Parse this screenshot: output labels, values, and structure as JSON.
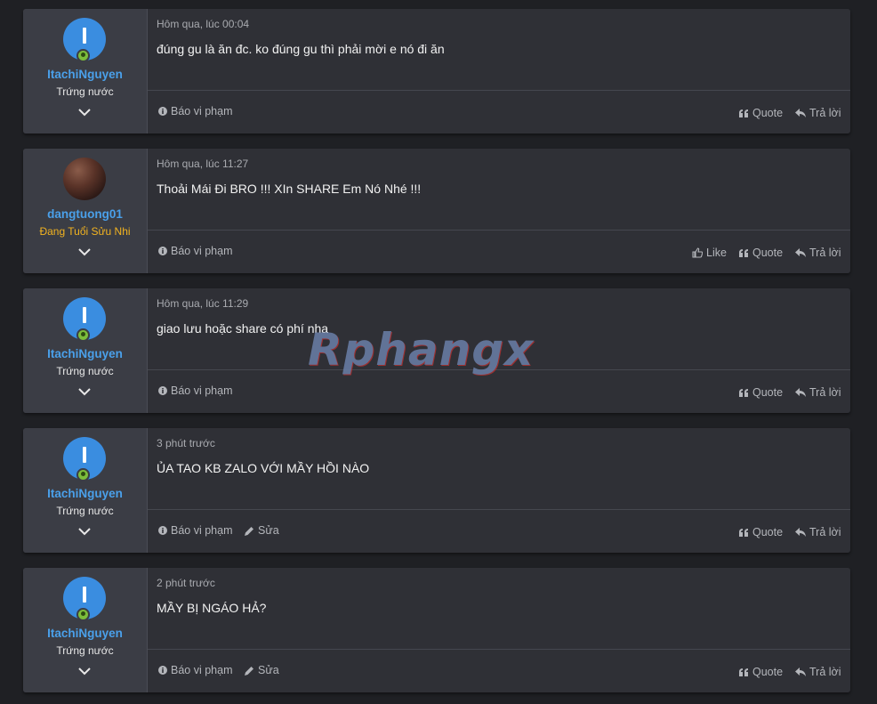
{
  "posts": [
    {
      "username": "ItachiNguyen",
      "user_title": "Trứng nước",
      "time": "Hôm qua, lúc 00:04",
      "message": "đúng gu là ăn đc. ko đúng gu thì phải mời e nó đi ăn",
      "actions_left": [
        "Báo vi phạm"
      ],
      "actions_right": [
        "Quote",
        "Trả lời"
      ]
    },
    {
      "username": "dangtuong01",
      "user_title": "Đang Tuổi Sửu Nhi",
      "time": "Hôm qua, lúc 11:27",
      "message": "Thoải Mái Đi BRO !!! XIn SHARE Em Nó Nhé !!!",
      "actions_left": [
        "Báo vi phạm"
      ],
      "actions_right": [
        "Like",
        "Quote",
        "Trả lời"
      ]
    },
    {
      "username": "ItachiNguyen",
      "user_title": "Trứng nước",
      "time": "Hôm qua, lúc 11:29",
      "message": "giao lưu hoặc share có phí nha",
      "actions_left": [
        "Báo vi phạm"
      ],
      "actions_right": [
        "Quote",
        "Trả lời"
      ]
    },
    {
      "username": "ItachiNguyen",
      "user_title": "Trứng nước",
      "time": "3 phút trước",
      "message": "ỦA TAO KB ZALO VỚI MẦY HỒI NÀO",
      "actions_left": [
        "Báo vi phạm",
        "Sửa"
      ],
      "actions_right": [
        "Quote",
        "Trả lời"
      ]
    },
    {
      "username": "ItachiNguyen",
      "user_title": "Trứng nước",
      "time": "2 phút trước",
      "message": "MẦY BỊ NGÁO HẢ?",
      "actions_left": [
        "Báo vi phạm",
        "Sửa"
      ],
      "actions_right": [
        "Quote",
        "Trả lời"
      ]
    }
  ],
  "watermark": "Rphangx",
  "colors": {
    "username": "#4aa0ea",
    "title_gold": "#f2b320",
    "online": "#7cbd3a",
    "avatar_blue": "#3a8de0"
  }
}
